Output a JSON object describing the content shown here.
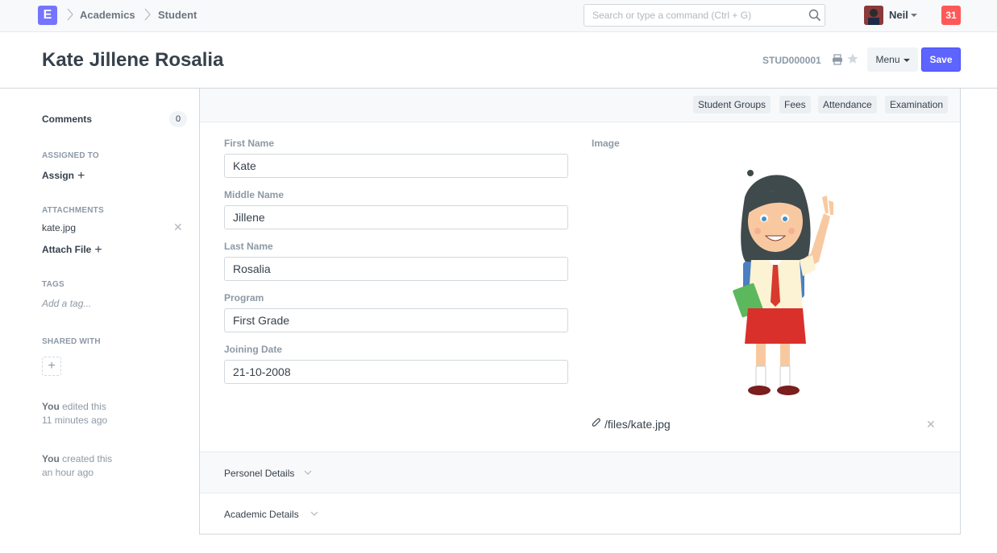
{
  "navbar": {
    "logo_letter": "E",
    "breadcrumbs": [
      "Academics",
      "Student"
    ],
    "search_placeholder": "Search or type a command (Ctrl + G)",
    "user_name": "Neil",
    "notification_count": "31",
    "colors": {
      "logo": "#7574ff",
      "badge": "#ff5858"
    }
  },
  "header": {
    "title": "Kate Jillene Rosalia",
    "doc_id": "STUD000001",
    "menu_label": "Menu",
    "save_label": "Save",
    "colors": {
      "primary": "#5e64ff"
    }
  },
  "sidebar": {
    "comments_label": "Comments",
    "comments_count": "0",
    "assigned_heading": "ASSIGNED TO",
    "assign_label": "Assign",
    "attachments_heading": "ATTACHMENTS",
    "attachment_file": "kate.jpg",
    "attach_label": "Attach File",
    "tags_heading": "TAGS",
    "tag_placeholder": "Add a tag...",
    "shared_heading": "SHARED WITH",
    "activity": [
      {
        "who": "You",
        "action": "edited this",
        "when": "11 minutes ago"
      },
      {
        "who": "You",
        "action": "created this",
        "when": "an hour ago"
      }
    ]
  },
  "dashboard": {
    "links": [
      "Student Groups",
      "Fees",
      "Attendance",
      "Examination"
    ]
  },
  "form": {
    "fields": [
      {
        "label": "First Name",
        "value": "Kate"
      },
      {
        "label": "Middle Name",
        "value": "Jillene"
      },
      {
        "label": "Last Name",
        "value": "Rosalia"
      },
      {
        "label": "Program",
        "value": "First Grade"
      },
      {
        "label": "Joining Date",
        "value": "21-10-2008"
      }
    ],
    "image_label": "Image",
    "image_path": "/files/kate.jpg",
    "sections": [
      "Personel Details",
      "Academic Details"
    ]
  }
}
